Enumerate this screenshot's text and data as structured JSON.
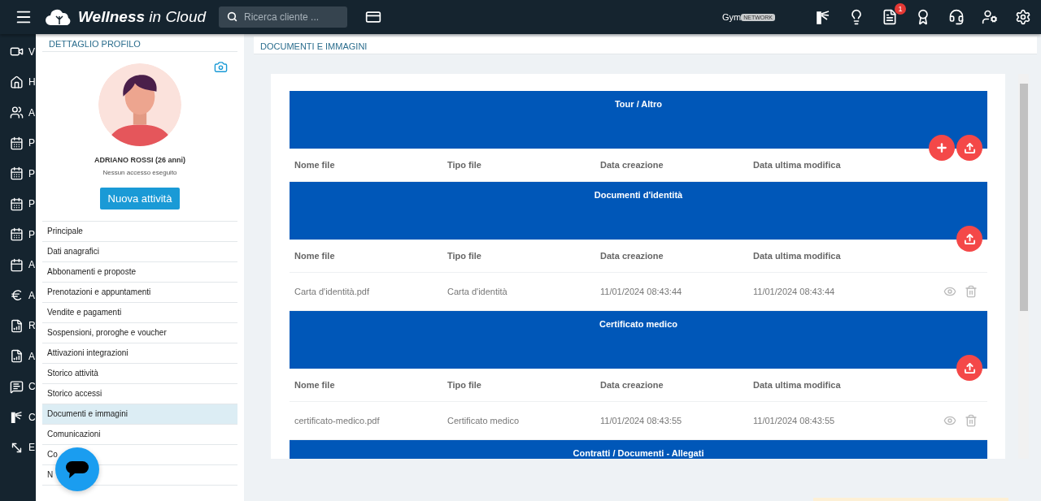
{
  "topbar": {
    "brand_bold": "Wellness",
    "brand_light": " in Cloud",
    "search": {
      "placeholder": "Ricerca cliente ..."
    },
    "gym": "Gym",
    "gym_badge": "NETWORK",
    "icons": [
      {
        "kind": "turnstile"
      },
      {
        "kind": "bulb"
      },
      {
        "kind": "document",
        "badge": "1"
      },
      {
        "kind": "award"
      },
      {
        "kind": "headset"
      },
      {
        "kind": "user-gear"
      },
      {
        "kind": "gear"
      }
    ]
  },
  "sidebar": {
    "items": [
      {
        "kind": "video",
        "letter": "V"
      },
      {
        "kind": "home",
        "letter": "H"
      },
      {
        "kind": "users",
        "letter": "A"
      },
      {
        "kind": "calendar",
        "letter": "P"
      },
      {
        "kind": "calendar",
        "letter": "P"
      },
      {
        "kind": "calendar",
        "letter": "P"
      },
      {
        "kind": "calendar",
        "letter": "P"
      },
      {
        "kind": "calendar31",
        "letter": "A"
      },
      {
        "kind": "euro",
        "letter": "A"
      },
      {
        "kind": "report",
        "letter": "R"
      },
      {
        "kind": "report",
        "letter": "A"
      },
      {
        "kind": "message",
        "letter": "C"
      },
      {
        "kind": "turnstile",
        "letter": "C"
      },
      {
        "kind": "expand",
        "letter": "E"
      }
    ]
  },
  "profile": {
    "title": "DETTAGLIO PROFILO",
    "name": "ADRIANO ROSSI (26 anni)",
    "access": "Nessun accesso eseguito",
    "action": "Nuova attività",
    "menu": [
      {
        "label": "Principale",
        "selected": false
      },
      {
        "label": "Dati anagrafici",
        "selected": false
      },
      {
        "label": "Abbonamenti e proposte",
        "selected": false
      },
      {
        "label": "Prenotazioni e appuntamenti",
        "selected": false
      },
      {
        "label": "Vendite e pagamenti",
        "selected": false
      },
      {
        "label": "Sospensioni, proroghe e voucher",
        "selected": false
      },
      {
        "label": "Attivazioni integrazioni",
        "selected": false
      },
      {
        "label": "Storico attività",
        "selected": false
      },
      {
        "label": "Storico accessi",
        "selected": false
      },
      {
        "label": "Documenti e immagini",
        "selected": true
      },
      {
        "label": "Comunicazioni",
        "selected": false
      },
      {
        "label": "Co",
        "selected": false
      },
      {
        "label": "N",
        "selected": false
      }
    ]
  },
  "documents": {
    "title": "DOCUMENTI E IMMAGINI",
    "sections": [
      {
        "title": "Tour / Altro",
        "buttons": [
          {
            "kind": "add"
          },
          {
            "kind": "upload"
          }
        ],
        "columns": [
          "Nome file",
          "Tipo file",
          "Data creazione",
          "Data ultima modifica"
        ]
      },
      {
        "title": "Documenti d'identità",
        "buttons": [
          {
            "kind": "upload"
          }
        ],
        "columns": [
          "Nome file",
          "Tipo file",
          "Data creazione",
          "Data ultima modifica"
        ],
        "rows": [
          {
            "cells": [
              "Carta d'identità.pdf",
              "Carta d'identità",
              "11/01/2024 08:43:44",
              "11/01/2024 08:43:44"
            ]
          }
        ]
      },
      {
        "title": "Certificato medico",
        "buttons": [
          {
            "kind": "upload"
          }
        ],
        "columns": [
          "Nome file",
          "Tipo file",
          "Data creazione",
          "Data ultima modifica"
        ],
        "rows": [
          {
            "cells": [
              "certificato-medico.pdf",
              "Certificato medico",
              "11/01/2024 08:43:55",
              "11/01/2024 08:43:55"
            ]
          }
        ]
      },
      {
        "title": "Contratti / Documenti - Allegati"
      }
    ]
  }
}
